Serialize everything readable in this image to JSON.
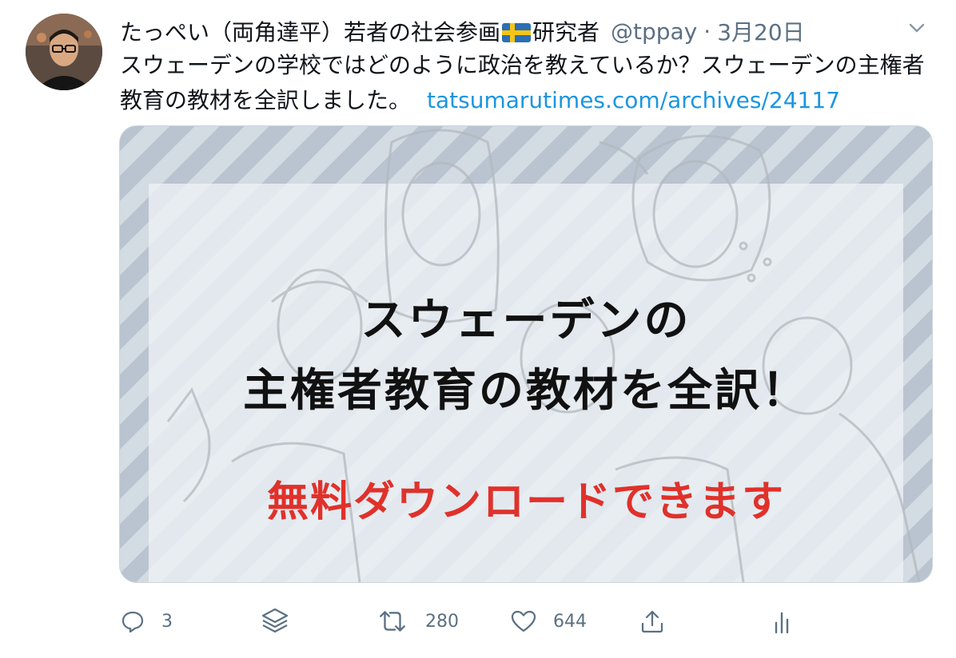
{
  "tweet": {
    "author_name": "たっぺい（両角達平）若者の社会参画",
    "author_name_suffix": "研究者",
    "flag_icon": "sweden-flag-icon",
    "handle": "@tppay",
    "separator": "·",
    "date": "3月20日",
    "text": "スウェーデンの学校ではどのように政治を教えているか？スウェーデンの主権者教育の教材を全訳しました。",
    "link_text": "tatsumarutimes.com/archives/24117"
  },
  "card": {
    "title_line1": "スウェーデンの",
    "title_line2": "主権者教育の教材を全訳！",
    "subtitle": "無料ダウンロードできます"
  },
  "actions": {
    "reply_count": "3",
    "retweet_count": "280",
    "like_count": "644"
  },
  "icons": [
    "chevron-down-icon",
    "reply-icon",
    "stack-icon",
    "retweet-icon",
    "heart-icon",
    "share-icon",
    "analytics-icon"
  ],
  "colors": {
    "link": "#1b95e0",
    "secondary_text": "#5b7083",
    "card_subtitle": "#e0312b"
  }
}
